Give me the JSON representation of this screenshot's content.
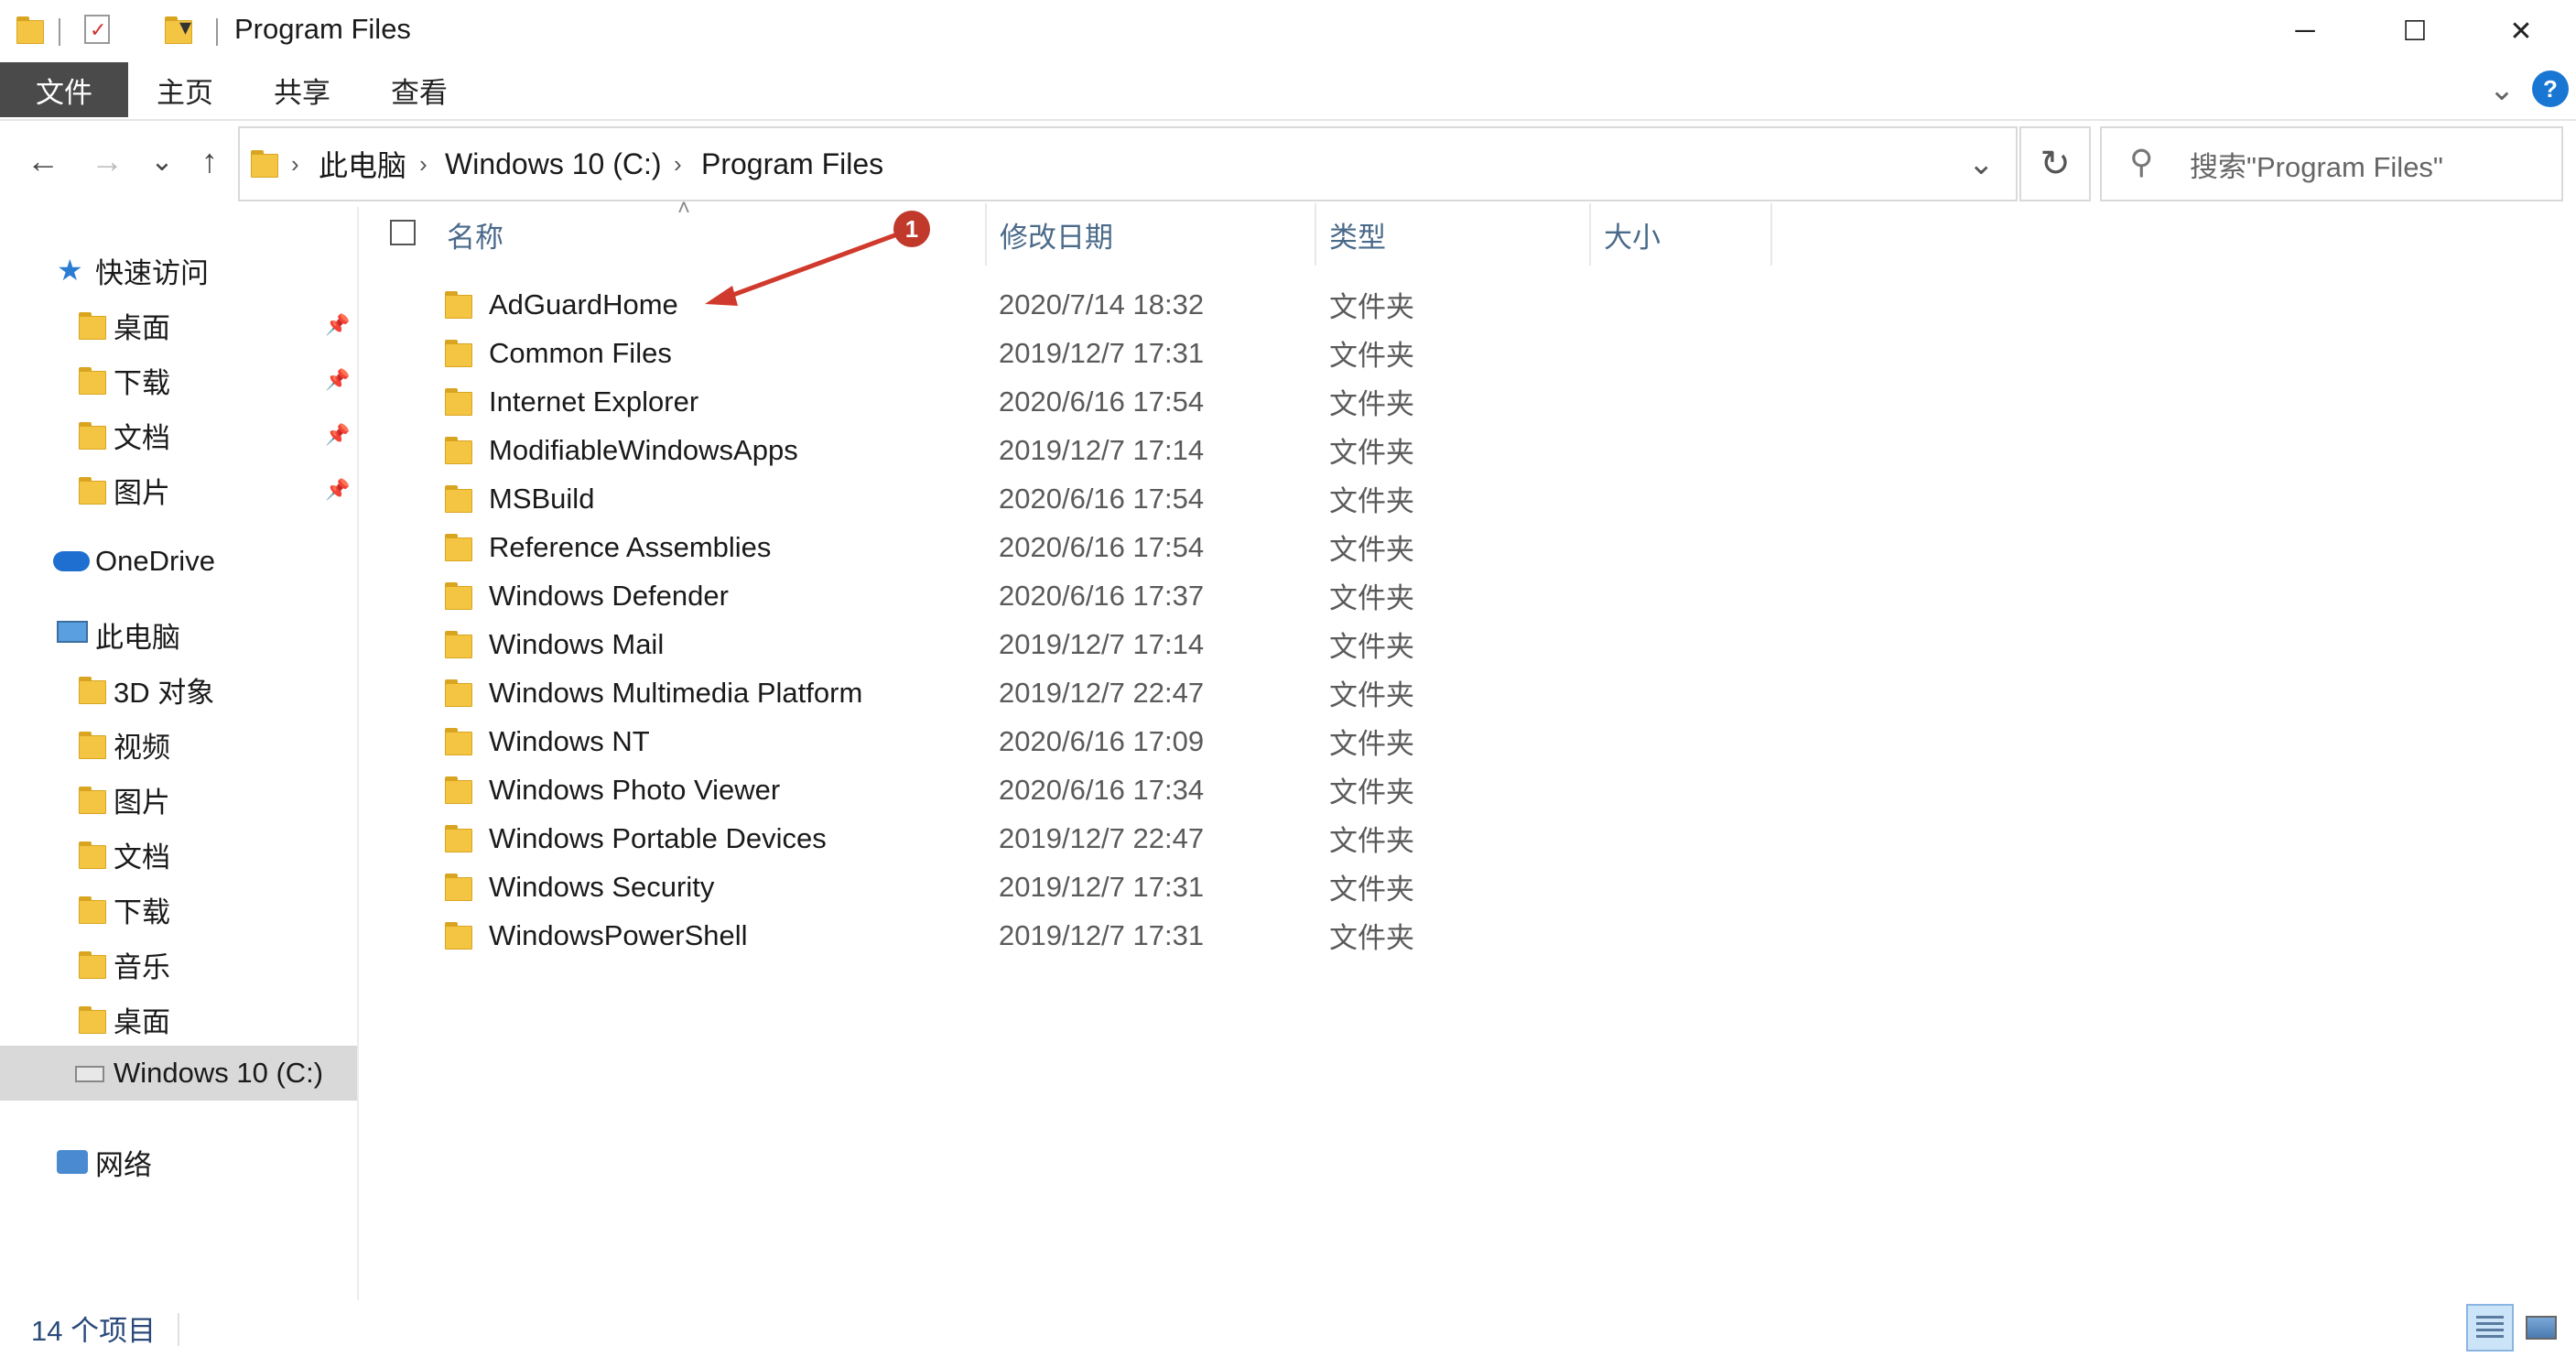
{
  "window": {
    "title": "Program Files",
    "minimize_glyph": "─",
    "maximize_glyph": "☐",
    "close_glyph": "✕"
  },
  "quick_access_toolbar": {
    "dropdown_glyph": "▾"
  },
  "ribbon": {
    "tabs": [
      {
        "label": "文件"
      },
      {
        "label": "主页"
      },
      {
        "label": "共享"
      },
      {
        "label": "查看"
      }
    ],
    "expand_glyph": "⌄",
    "help_glyph": "?"
  },
  "navigation": {
    "back_glyph": "←",
    "forward_glyph": "→",
    "recent_glyph": "⌄",
    "up_glyph": "↑",
    "breadcrumb": [
      {
        "label": "此电脑"
      },
      {
        "label": "Windows 10 (C:)"
      },
      {
        "label": "Program Files"
      }
    ],
    "crumb_separator": "›",
    "address_dropdown_glyph": "⌄",
    "refresh_glyph": "↻",
    "search_glyph": "⚲",
    "search_placeholder": "搜索\"Program Files\""
  },
  "sidebar": {
    "quick_access": {
      "label": "快速访问",
      "items": [
        {
          "label": "桌面",
          "icon": "desktop-folder-icon",
          "pinned": true
        },
        {
          "label": "下载",
          "icon": "downloads-folder-icon",
          "pinned": true
        },
        {
          "label": "文档",
          "icon": "documents-folder-icon",
          "pinned": true
        },
        {
          "label": "图片",
          "icon": "pictures-folder-icon",
          "pinned": true
        }
      ]
    },
    "onedrive": {
      "label": "OneDrive",
      "icon": "onedrive-cloud-icon"
    },
    "this_pc": {
      "label": "此电脑",
      "items": [
        {
          "label": "3D 对象",
          "icon": "3d-objects-folder-icon"
        },
        {
          "label": "视频",
          "icon": "videos-folder-icon"
        },
        {
          "label": "图片",
          "icon": "pictures-folder-icon"
        },
        {
          "label": "文档",
          "icon": "documents-folder-icon"
        },
        {
          "label": "下载",
          "icon": "downloads-folder-icon"
        },
        {
          "label": "音乐",
          "icon": "music-folder-icon"
        },
        {
          "label": "桌面",
          "icon": "desktop-folder-icon"
        },
        {
          "label": "Windows 10 (C:)",
          "icon": "drive-icon",
          "selected": true
        }
      ]
    },
    "network": {
      "label": "网络",
      "icon": "network-icon"
    },
    "pin_glyph": "📌"
  },
  "columns": {
    "name": "名称",
    "date": "修改日期",
    "type": "类型",
    "size": "大小",
    "sort_glyph": "˄"
  },
  "files": [
    {
      "name": "AdGuardHome",
      "date": "2020/7/14 18:32",
      "type": "文件夹"
    },
    {
      "name": "Common Files",
      "date": "2019/12/7 17:31",
      "type": "文件夹"
    },
    {
      "name": "Internet Explorer",
      "date": "2020/6/16 17:54",
      "type": "文件夹"
    },
    {
      "name": "ModifiableWindowsApps",
      "date": "2019/12/7 17:14",
      "type": "文件夹"
    },
    {
      "name": "MSBuild",
      "date": "2020/6/16 17:54",
      "type": "文件夹"
    },
    {
      "name": "Reference Assemblies",
      "date": "2020/6/16 17:54",
      "type": "文件夹"
    },
    {
      "name": "Windows Defender",
      "date": "2020/6/16 17:37",
      "type": "文件夹"
    },
    {
      "name": "Windows Mail",
      "date": "2019/12/7 17:14",
      "type": "文件夹"
    },
    {
      "name": "Windows Multimedia Platform",
      "date": "2019/12/7 22:47",
      "type": "文件夹"
    },
    {
      "name": "Windows NT",
      "date": "2020/6/16 17:09",
      "type": "文件夹"
    },
    {
      "name": "Windows Photo Viewer",
      "date": "2020/6/16 17:34",
      "type": "文件夹"
    },
    {
      "name": "Windows Portable Devices",
      "date": "2019/12/7 22:47",
      "type": "文件夹"
    },
    {
      "name": "Windows Security",
      "date": "2019/12/7 17:31",
      "type": "文件夹"
    },
    {
      "name": "WindowsPowerShell",
      "date": "2019/12/7 17:31",
      "type": "文件夹"
    }
  ],
  "annotation": {
    "number": "1",
    "color": "#c0392b"
  },
  "status_bar": {
    "item_count": "14 个项目"
  },
  "colors": {
    "accent_selected": "#cce4f7",
    "file_tab": "#4a4a4a",
    "help": "#1976d2",
    "column_header": "#4a6a8a",
    "folder": "#f4c542"
  }
}
